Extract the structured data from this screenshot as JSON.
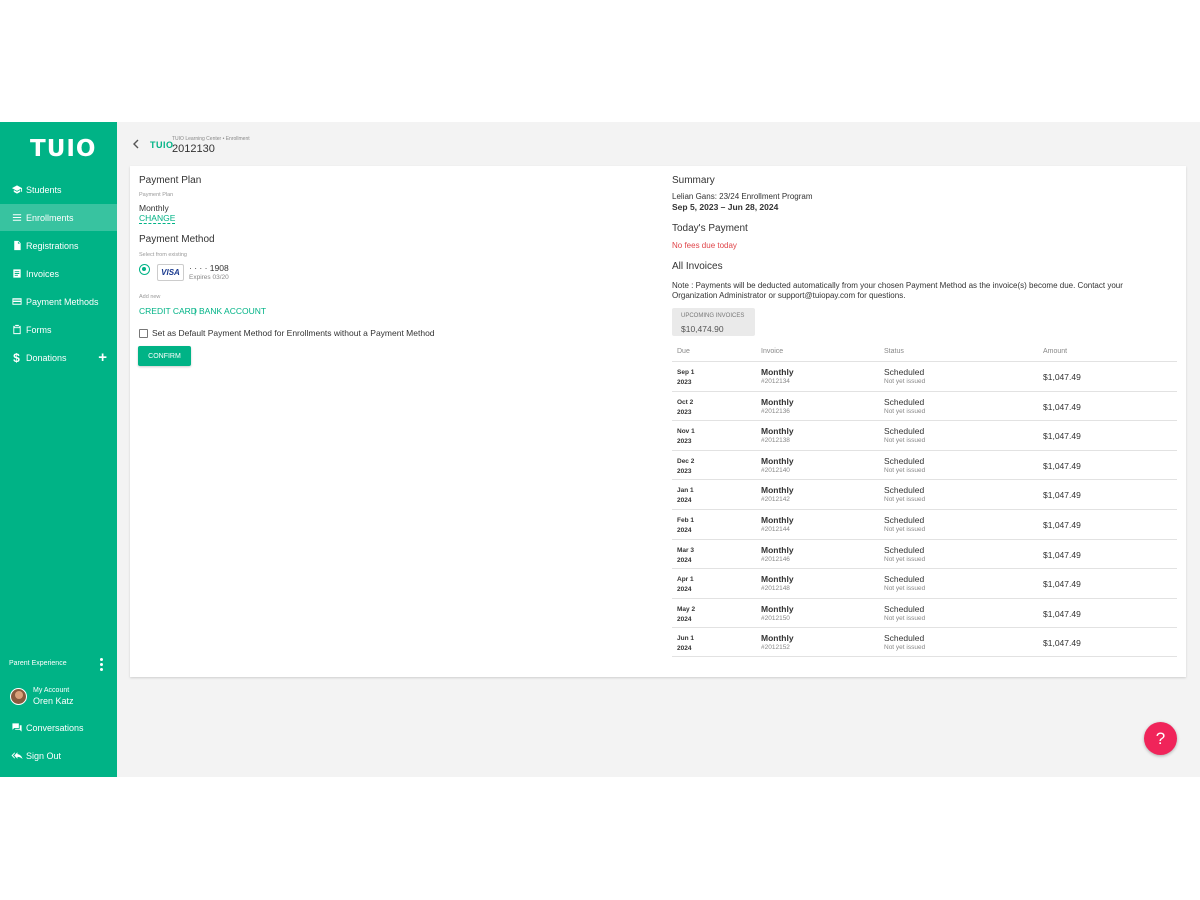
{
  "sidebar": {
    "logo": "TUIO",
    "items": [
      {
        "label": "Students",
        "icon": "graduation-cap-icon"
      },
      {
        "label": "Enrollments",
        "icon": "list-icon"
      },
      {
        "label": "Registrations",
        "icon": "document-icon"
      },
      {
        "label": "Invoices",
        "icon": "invoice-icon"
      },
      {
        "label": "Payment Methods",
        "icon": "credit-card-icon"
      },
      {
        "label": "Forms",
        "icon": "clipboard-icon"
      },
      {
        "label": "Donations",
        "icon": "dollar-icon"
      }
    ],
    "active": "Enrollments",
    "donations_add": "+",
    "section_label": "Parent Experience",
    "account_label": "My Account",
    "account_name": "Oren Katz",
    "conversations": "Conversations",
    "sign_out": "Sign Out"
  },
  "header": {
    "logo": "TUIO",
    "breadcrumb": "TUIO Learning Center • Enrollment",
    "title": "2012130"
  },
  "left": {
    "payment_plan_heading": "Payment Plan",
    "payment_plan_label": "Payment Plan",
    "plan_value": "Monthly",
    "change_link": "CHANGE",
    "payment_method_heading": "Payment Method",
    "select_label": "Select from existing",
    "card_brand": "VISA",
    "card_number": "· · · · 1908",
    "card_expiry": "Expires 03/20",
    "add_new_label": "Add new",
    "credit_card_link": "CREDIT CARD",
    "separator": "|",
    "bank_account_link": "BANK ACCOUNT",
    "default_checkbox_label": "Set as Default Payment Method for Enrollments without a Payment Method",
    "confirm_button": "CONFIRM"
  },
  "right": {
    "summary_heading": "Summary",
    "program": "Lelian Gans: 23/24 Enrollment Program",
    "dates": "Sep 5, 2023 – Jun 28, 2024",
    "todays_payment_heading": "Today's Payment",
    "no_fees": "No fees due today",
    "all_invoices_heading": "All Invoices",
    "note_line1": "Note : Payments will be deducted automatically from your chosen Payment Method as the invoice(s) become due. Contact your",
    "note_line2": "Organization Administrator or support@tuiopay.com for questions.",
    "upcoming_label": "UPCOMING INVOICES",
    "upcoming_value": "$10,474.90",
    "columns": [
      "Due",
      "Invoice",
      "Status",
      "Amount"
    ],
    "invoices": [
      {
        "due_day": "Sep 1",
        "due_year": "2023",
        "plan": "Monthly",
        "number": "#2012134",
        "status": "Scheduled",
        "status_sub": "Not yet issued",
        "amount": "$1,047.49"
      },
      {
        "due_day": "Oct 2",
        "due_year": "2023",
        "plan": "Monthly",
        "number": "#2012136",
        "status": "Scheduled",
        "status_sub": "Not yet issued",
        "amount": "$1,047.49"
      },
      {
        "due_day": "Nov 1",
        "due_year": "2023",
        "plan": "Monthly",
        "number": "#2012138",
        "status": "Scheduled",
        "status_sub": "Not yet issued",
        "amount": "$1,047.49"
      },
      {
        "due_day": "Dec 2",
        "due_year": "2023",
        "plan": "Monthly",
        "number": "#2012140",
        "status": "Scheduled",
        "status_sub": "Not yet issued",
        "amount": "$1,047.49"
      },
      {
        "due_day": "Jan 1",
        "due_year": "2024",
        "plan": "Monthly",
        "number": "#2012142",
        "status": "Scheduled",
        "status_sub": "Not yet issued",
        "amount": "$1,047.49"
      },
      {
        "due_day": "Feb 1",
        "due_year": "2024",
        "plan": "Monthly",
        "number": "#2012144",
        "status": "Scheduled",
        "status_sub": "Not yet issued",
        "amount": "$1,047.49"
      },
      {
        "due_day": "Mar 3",
        "due_year": "2024",
        "plan": "Monthly",
        "number": "#2012146",
        "status": "Scheduled",
        "status_sub": "Not yet issued",
        "amount": "$1,047.49"
      },
      {
        "due_day": "Apr 1",
        "due_year": "2024",
        "plan": "Monthly",
        "number": "#2012148",
        "status": "Scheduled",
        "status_sub": "Not yet issued",
        "amount": "$1,047.49"
      },
      {
        "due_day": "May 2",
        "due_year": "2024",
        "plan": "Monthly",
        "number": "#2012150",
        "status": "Scheduled",
        "status_sub": "Not yet issued",
        "amount": "$1,047.49"
      },
      {
        "due_day": "Jun 1",
        "due_year": "2024",
        "plan": "Monthly",
        "number": "#2012152",
        "status": "Scheduled",
        "status_sub": "Not yet issued",
        "amount": "$1,047.49"
      }
    ]
  },
  "help_button": "?",
  "colors": {
    "brand": "#00b386",
    "danger": "#e0454a",
    "help": "#f0245a"
  }
}
